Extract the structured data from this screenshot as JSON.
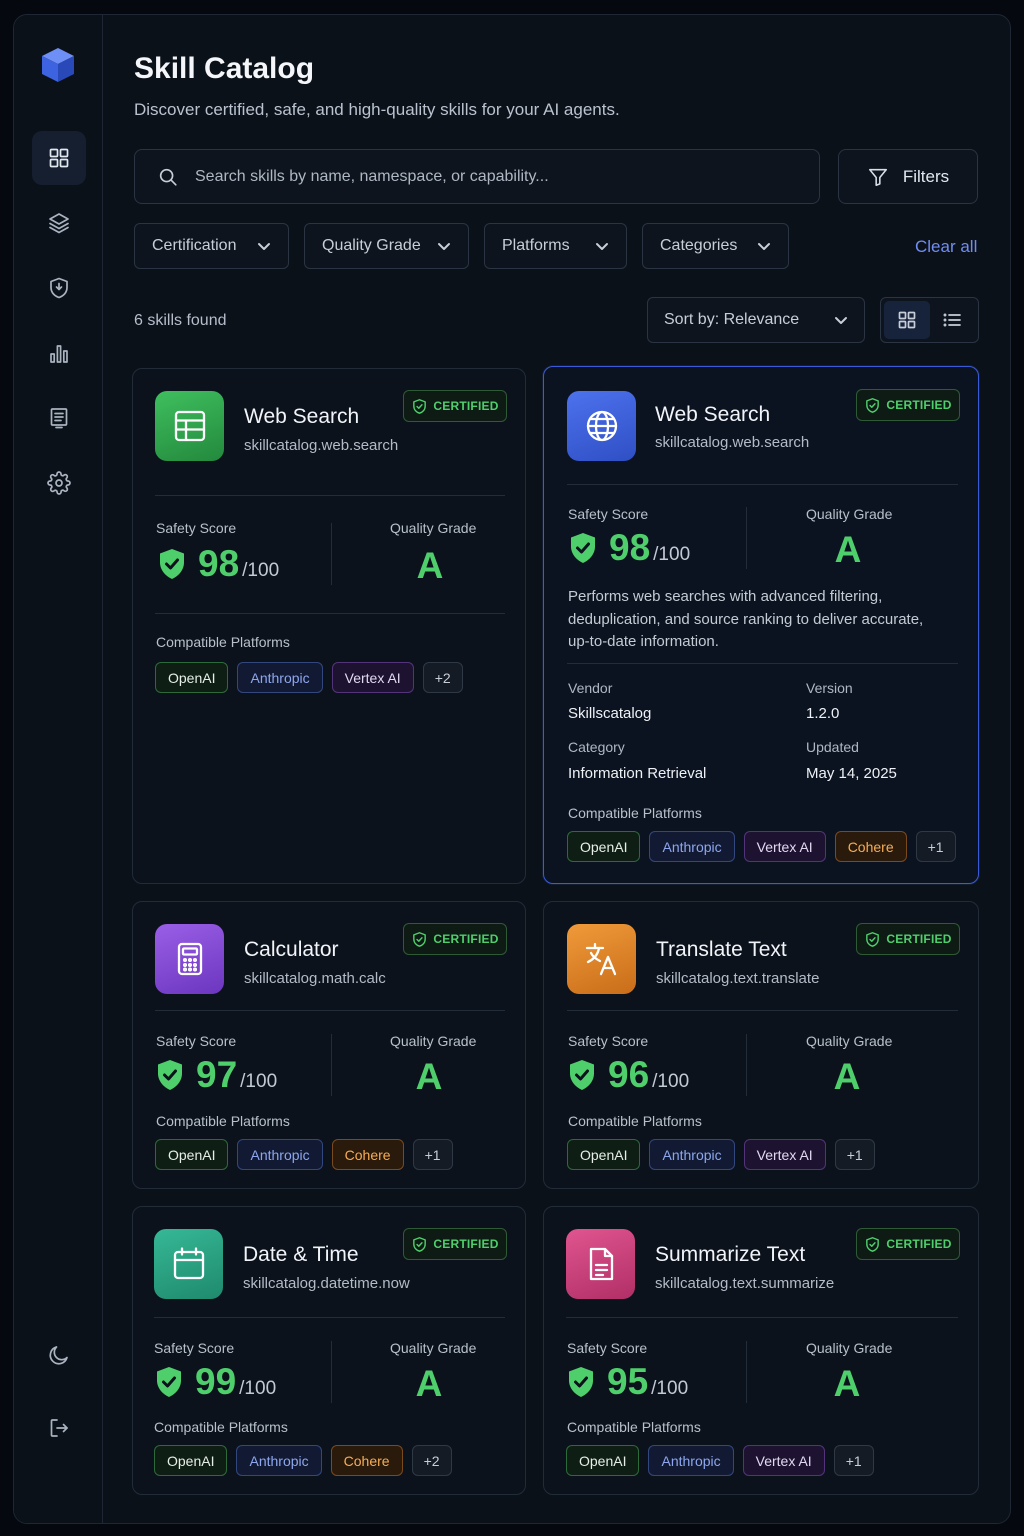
{
  "app": {
    "title": "Skill Catalog",
    "subtitle": "Discover certified, safe, and high-quality skills for your AI agents."
  },
  "sidebar": {
    "items": [
      {
        "icon": "grid-icon",
        "active": true
      },
      {
        "icon": "layers-icon",
        "active": false
      },
      {
        "icon": "shield-icon",
        "active": false
      },
      {
        "icon": "bar-chart-icon",
        "active": false
      },
      {
        "icon": "document-icon",
        "active": false
      },
      {
        "icon": "gear-icon",
        "active": false
      }
    ],
    "bottom": [
      {
        "icon": "moon-icon"
      },
      {
        "icon": "logout-icon"
      }
    ]
  },
  "search": {
    "placeholder": "Search skills by name, namespace, or capability...",
    "value": ""
  },
  "filters_label": "Filters",
  "filter_dropdowns": [
    "Certification",
    "Quality Grade",
    "Platforms",
    "Categories"
  ],
  "clear_all": "Clear all",
  "results_count": "6 skills found",
  "sort_label": "Sort by: Relevance",
  "view_modes": [
    "grid",
    "list"
  ],
  "labels": {
    "certified": "CERTIFIED",
    "safety_score": "Safety Score",
    "quality_grade": "Quality Grade",
    "compatible_platforms": "Compatible Platforms",
    "score_max": "/100",
    "vendor": "Vendor",
    "version": "Version",
    "category": "Category",
    "updated": "Updated"
  },
  "colors": {
    "accent": "#3a5bd9",
    "success": "#4fcf6c",
    "link": "#6f8df2"
  },
  "skills": [
    {
      "name": "Web Search",
      "namespace": "skillcatalog.web.search",
      "icon": "table-icon",
      "icon_color": "#34a853",
      "safety_score": "98",
      "quality_grade": "A",
      "platforms": [
        "OpenAI",
        "Anthropic",
        "Vertex AI",
        "+2"
      ]
    },
    {
      "name": "Web Search",
      "namespace": "skillcatalog.web.search",
      "icon": "globe-icon",
      "icon_color": "#3e63dd",
      "safety_score": "98",
      "quality_grade": "A",
      "description": "Performs web searches with advanced filtering, deduplication, and source ranking to deliver accurate, up-to-date information.",
      "vendor": "Skillscatalog",
      "version": "1.2.0",
      "category": "Information Retrieval",
      "updated": "May 14, 2025",
      "platforms": [
        "OpenAI",
        "Anthropic",
        "Vertex AI",
        "Cohere",
        "+1"
      ]
    },
    {
      "name": "Calculator",
      "namespace": "skillcatalog.math.calc",
      "icon": "calculator-icon",
      "icon_color": "#8b4fd9",
      "safety_score": "97",
      "quality_grade": "A",
      "platforms": [
        "OpenAI",
        "Anthropic",
        "Cohere",
        "+1"
      ]
    },
    {
      "name": "Translate Text",
      "namespace": "skillcatalog.text.translate",
      "icon": "translate-icon",
      "icon_color": "#e58a2a",
      "safety_score": "96",
      "quality_grade": "A",
      "platforms": [
        "OpenAI",
        "Anthropic",
        "Vertex AI",
        "+1"
      ]
    },
    {
      "name": "Date & Time",
      "namespace": "skillcatalog.datetime.now",
      "icon": "calendar-icon",
      "icon_color": "#2ea88a",
      "safety_score": "99",
      "quality_grade": "A",
      "platforms": [
        "OpenAI",
        "Anthropic",
        "Cohere",
        "+2"
      ]
    },
    {
      "name": "Summarize Text",
      "namespace": "skillcatalog.text.summarize",
      "icon": "file-text-icon",
      "icon_color": "#d1447e",
      "safety_score": "95",
      "quality_grade": "A",
      "platforms": [
        "OpenAI",
        "Anthropic",
        "Vertex AI",
        "+1"
      ]
    }
  ]
}
